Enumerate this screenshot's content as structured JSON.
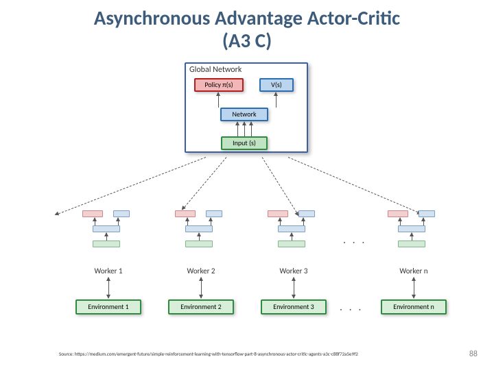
{
  "title_line1": "Asynchronous Advantage Actor-Critic",
  "title_line2": "(A3 C)",
  "global": {
    "label": "Global Network",
    "policy": "Policy π(s)",
    "value": "V(s)",
    "network": "Network",
    "input": "Input (s)"
  },
  "workers": {
    "w1": "Worker 1",
    "w2": "Worker 2",
    "w3": "Worker 3",
    "wn": "Worker n"
  },
  "environments": {
    "e1": "Environment 1",
    "e2": "Environment 2",
    "e3": "Environment 3",
    "en": "Environment n"
  },
  "ellipsis": ". . .",
  "source": "Source: https://medium.com/emergent-future/simple-reinforcement-learning-with-tensorflow-part-8-asynchronous-actor-critic-agents-a3c-c88f72a5e9f2",
  "page_number": "88"
}
